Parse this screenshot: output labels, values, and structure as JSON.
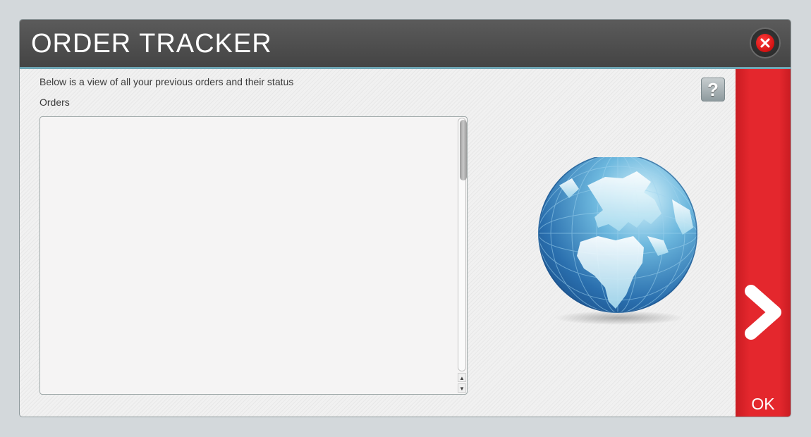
{
  "dialog": {
    "title": "ORDER TRACKER",
    "close_icon": "close-icon",
    "description": "Below is a view of all your previous orders and their status",
    "orders_label": "Orders",
    "help_icon": "question-mark-icon",
    "help_symbol": "?",
    "orders": [],
    "scroll_up_symbol": "▲",
    "scroll_down_symbol": "▼",
    "illustration": "globe-icon",
    "ok_label": "OK",
    "ok_icon": "chevron-right-icon"
  },
  "colors": {
    "titlebar": "#4d4d4d",
    "accent_red": "#e4272d",
    "close_red": "#d10000"
  }
}
